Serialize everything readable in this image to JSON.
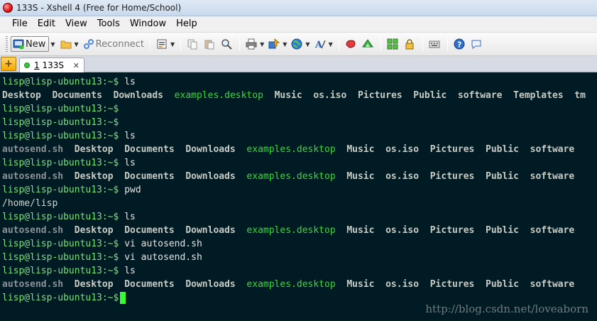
{
  "window": {
    "title": "133S - Xshell 4 (Free for Home/School)"
  },
  "menu": [
    "File",
    "Edit",
    "View",
    "Tools",
    "Window",
    "Help"
  ],
  "toolbar": {
    "new_label": "New",
    "reconnect_label": "Reconnect"
  },
  "tabs": [
    {
      "number": "1",
      "name": "133S",
      "status_color": "#39c439"
    }
  ],
  "terminal": {
    "prompt": "lisp@lisp-ubuntu13:~$",
    "lines": [
      {
        "type": "prompt",
        "cmd": "ls"
      },
      {
        "type": "ls",
        "items": [
          {
            "t": "Desktop",
            "k": "dir"
          },
          {
            "t": "Documents",
            "k": "dir"
          },
          {
            "t": "Downloads",
            "k": "dir"
          },
          {
            "t": "examples.desktop",
            "k": "desk"
          },
          {
            "t": "Music",
            "k": "dir"
          },
          {
            "t": "os.iso",
            "k": "dir"
          },
          {
            "t": "Pictures",
            "k": "dir"
          },
          {
            "t": "Public",
            "k": "dir"
          },
          {
            "t": "software",
            "k": "dir"
          },
          {
            "t": "Templates",
            "k": "dir"
          },
          {
            "t": "tm",
            "k": "dir"
          }
        ]
      },
      {
        "type": "prompt",
        "cmd": ""
      },
      {
        "type": "prompt",
        "cmd": ""
      },
      {
        "type": "prompt",
        "cmd": "ls"
      },
      {
        "type": "ls",
        "items": [
          {
            "t": "autosend.sh",
            "k": "file"
          },
          {
            "t": "Desktop",
            "k": "dir"
          },
          {
            "t": "Documents",
            "k": "dir"
          },
          {
            "t": "Downloads",
            "k": "dir"
          },
          {
            "t": "examples.desktop",
            "k": "desk"
          },
          {
            "t": "Music",
            "k": "dir"
          },
          {
            "t": "os.iso",
            "k": "dir"
          },
          {
            "t": "Pictures",
            "k": "dir"
          },
          {
            "t": "Public",
            "k": "dir"
          },
          {
            "t": "software",
            "k": "dir"
          }
        ]
      },
      {
        "type": "prompt",
        "cmd": "ls"
      },
      {
        "type": "ls",
        "items": [
          {
            "t": "autosend.sh",
            "k": "file"
          },
          {
            "t": "Desktop",
            "k": "dir"
          },
          {
            "t": "Documents",
            "k": "dir"
          },
          {
            "t": "Downloads",
            "k": "dir"
          },
          {
            "t": "examples.desktop",
            "k": "desk"
          },
          {
            "t": "Music",
            "k": "dir"
          },
          {
            "t": "os.iso",
            "k": "dir"
          },
          {
            "t": "Pictures",
            "k": "dir"
          },
          {
            "t": "Public",
            "k": "dir"
          },
          {
            "t": "software",
            "k": "dir"
          }
        ]
      },
      {
        "type": "prompt",
        "cmd": "pwd"
      },
      {
        "type": "output",
        "text": "/home/lisp"
      },
      {
        "type": "prompt",
        "cmd": "ls"
      },
      {
        "type": "ls",
        "items": [
          {
            "t": "autosend.sh",
            "k": "file"
          },
          {
            "t": "Desktop",
            "k": "dir"
          },
          {
            "t": "Documents",
            "k": "dir"
          },
          {
            "t": "Downloads",
            "k": "dir"
          },
          {
            "t": "examples.desktop",
            "k": "desk"
          },
          {
            "t": "Music",
            "k": "dir"
          },
          {
            "t": "os.iso",
            "k": "dir"
          },
          {
            "t": "Pictures",
            "k": "dir"
          },
          {
            "t": "Public",
            "k": "dir"
          },
          {
            "t": "software",
            "k": "dir"
          }
        ]
      },
      {
        "type": "prompt",
        "cmd": "vi autosend.sh"
      },
      {
        "type": "prompt",
        "cmd": "vi autosend.sh"
      },
      {
        "type": "prompt",
        "cmd": "ls"
      },
      {
        "type": "ls",
        "items": [
          {
            "t": "autosend.sh",
            "k": "file"
          },
          {
            "t": "Desktop",
            "k": "dir"
          },
          {
            "t": "Documents",
            "k": "dir"
          },
          {
            "t": "Downloads",
            "k": "dir"
          },
          {
            "t": "examples.desktop",
            "k": "desk"
          },
          {
            "t": "Music",
            "k": "dir"
          },
          {
            "t": "os.iso",
            "k": "dir"
          },
          {
            "t": "Pictures",
            "k": "dir"
          },
          {
            "t": "Public",
            "k": "dir"
          },
          {
            "t": "software",
            "k": "dir"
          }
        ]
      },
      {
        "type": "prompt",
        "cmd": "",
        "cursor": true
      }
    ]
  },
  "watermark": "http://blog.csdn.net/loveaborn",
  "colors": {
    "terminal_bg": "#001b24",
    "prompt": "#7ee07e",
    "directory": "#c9ccc4",
    "executable_desktop": "#33dd33",
    "script_file": "#8b9196",
    "cursor": "#33ff33"
  }
}
